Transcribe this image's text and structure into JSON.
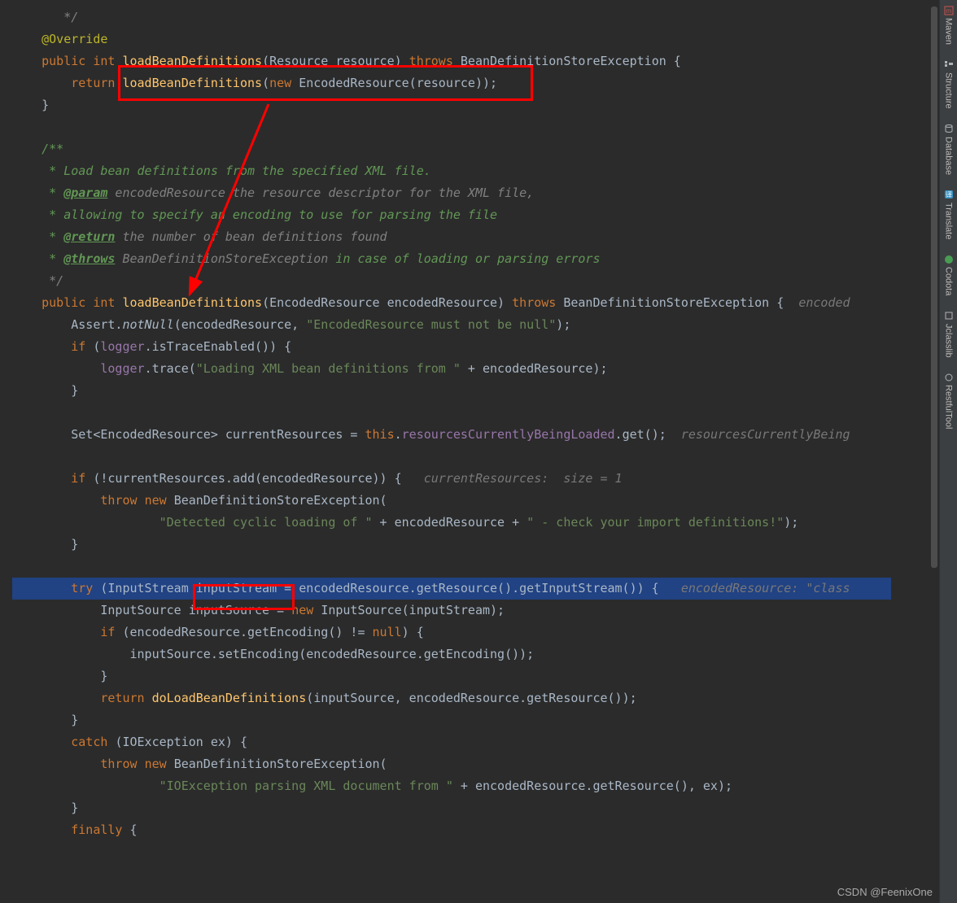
{
  "code": {
    "l1": "   */",
    "l2_ann": "@Override",
    "l3_kw1": "public ",
    "l3_kw2": "int ",
    "l3_m": "loadBeanDefinitions",
    "l3_r1": "(Resource resource) ",
    "l3_kw3": "throws ",
    "l3_r2": "BeanDefinitionStoreException {",
    "l4_kw": "return ",
    "l4_m": "loadBeanDefinitions",
    "l4_r1": "(",
    "l4_kw2": "new ",
    "l4_r2": "EncodedResource(resource));",
    "l5": "}",
    "l7": "/**",
    "l8": " * Load bean definitions from the specified XML file.",
    "l9a": " * ",
    "l9t": "@param",
    "l9b": " encodedResource the resource descriptor for the XML file,",
    "l10": " * allowing to specify an encoding to use for parsing the file",
    "l11a": " * ",
    "l11t": "@return",
    "l11b": " the number of bean definitions found",
    "l12a": " * ",
    "l12t": "@throws",
    "l12b": " BeanDefinitionStoreException ",
    "l12c": "in case of loading or parsing errors",
    "l13": " */",
    "l14_kw1": "public ",
    "l14_kw2": "int ",
    "l14_m": "loadBeanDefinitions",
    "l14_r1": "(EncodedResource encodedResource) ",
    "l14_kw3": "throws ",
    "l14_r2": "BeanDefinitionStoreException {  ",
    "l14_h": "encoded",
    "l15_c": "Assert.",
    "l15_m": "notNull",
    "l15_r1": "(encodedResource, ",
    "l15_s": "\"EncodedResource must not be null\"",
    "l15_r2": ");",
    "l16_kw": "if ",
    "l16_r1": "(",
    "l16_f": "logger",
    "l16_r2": ".isTraceEnabled()) {",
    "l17_f": "logger",
    "l17_r1": ".trace(",
    "l17_s": "\"Loading XML bean definitions from \"",
    "l17_r2": " + encodedResource);",
    "l18": "}",
    "l20_r1": "Set<EncodedResource> currentResources = ",
    "l20_kw": "this",
    "l20_r2": ".",
    "l20_f": "resourcesCurrentlyBeingLoaded",
    "l20_r3": ".get();  ",
    "l20_h": "resourcesCurrentlyBeing",
    "l22_kw": "if ",
    "l22_r1": "(!currentResources.add(encodedResource)) {   ",
    "l22_h": "currentResources:  size = 1",
    "l23_kw1": "throw ",
    "l23_kw2": "new ",
    "l23_r": "BeanDefinitionStoreException(",
    "l24_s1": "\"Detected cyclic loading of \"",
    "l24_r": " + encodedResource + ",
    "l24_s2": "\" - check your import definitions!\"",
    "l24_r2": ");",
    "l25": "}",
    "l27_kw": "try ",
    "l27_r1": "(InputStream inputStream = encodedResource.getResource().getInputStream()) {   ",
    "l27_h": "encodedResource: \"class",
    "l28_r1": "InputSource inputSource = ",
    "l28_kw": "new ",
    "l28_r2": "InputSource(inputStream);",
    "l29_kw": "if ",
    "l29_r1": "(encodedResource.getEncoding() != ",
    "l29_kw2": "null",
    "l29_r2": ") {",
    "l30": "inputSource.setEncoding(encodedResource.getEncoding());",
    "l31": "}",
    "l32_kw": "return ",
    "l32_m": "doLoadBeanDefinitions",
    "l32_r": "(inputSource, encodedResource.getResource());",
    "l33": "}",
    "l34_kw": "catch ",
    "l34_r": "(IOException ex) {",
    "l35_kw1": "throw ",
    "l35_kw2": "new ",
    "l35_r": "BeanDefinitionStoreException(",
    "l36_s": "\"IOException parsing XML document from \"",
    "l36_r": " + encodedResource.getResource(), ex);",
    "l37": "}",
    "l38_kw": "finally ",
    "l38_r": "{"
  },
  "indent": {
    "i0": "",
    "i1": "    ",
    "i2": "        ",
    "i3": "            ",
    "i4": "                ",
    "i5": "                    "
  },
  "tools": {
    "t1": "Maven",
    "t2": "Structure",
    "t3": "Database",
    "t4": "Translate",
    "t5": "Codota",
    "t6": "Jclasslib",
    "t7": "RestfulTool"
  },
  "watermark": "CSDN @FeenixOne"
}
